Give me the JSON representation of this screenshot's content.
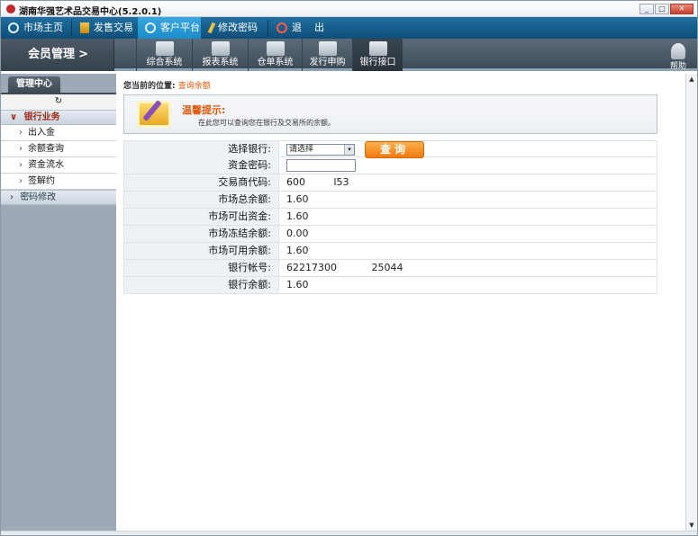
{
  "window": {
    "title": "湖南华强艺术品交易中心(5.2.0.1)"
  },
  "top_nav": [
    {
      "label": "市场主页",
      "icon": "globe-icon"
    },
    {
      "label": "发售交易",
      "icon": "money-icon"
    },
    {
      "label": "客户平台",
      "icon": "globe-icon",
      "active": true
    },
    {
      "label": "修改密码",
      "icon": "pen-icon"
    },
    {
      "label": "退",
      "icon": "power-icon"
    },
    {
      "label": "出",
      "icon": ""
    }
  ],
  "sub_nav": {
    "member": "会员管理",
    "member_arrow": ">",
    "items": [
      "综合系统",
      "报表系统",
      "仓单系统",
      "发行申购",
      "银行接口"
    ],
    "active": "银行接口",
    "help": "帮助"
  },
  "left_panel": {
    "tab": "管理中心",
    "groups": [
      {
        "label": "银行业务",
        "expanded": true,
        "items": [
          "出入金",
          "余额查询",
          "资金流水",
          "签解约"
        ]
      },
      {
        "label": "密码修改",
        "expanded": false
      }
    ]
  },
  "breadcrumb": {
    "prefix": "您当前的位置:",
    "current": "查询余额"
  },
  "tip": {
    "title": "温馨提示:",
    "text": "在此您可以查询您在银行及交易所的余额。"
  },
  "form": {
    "bank_label": "选择银行:",
    "bank_value": "请选择",
    "query_button": "查询",
    "password_label": "资金密码:",
    "rows": [
      {
        "label": "交易商代码:",
        "value": "600         l53"
      },
      {
        "label": "市场总余额:",
        "value": "1.60"
      },
      {
        "label": "市场可出资金:",
        "value": "1.60"
      },
      {
        "label": "市场冻结余额:",
        "value": "0.00"
      },
      {
        "label": "市场可用余额:",
        "value": "1.60"
      },
      {
        "label": "银行帐号:",
        "value": "62217300           25044"
      },
      {
        "label": "银行余额:",
        "value": "1.60"
      }
    ]
  },
  "colors": {
    "nav_bg": "#1f6f9f",
    "active_tab": "#37a7de",
    "accent_orange": "#e05a10",
    "sidebar_bg": "#9daab5"
  }
}
